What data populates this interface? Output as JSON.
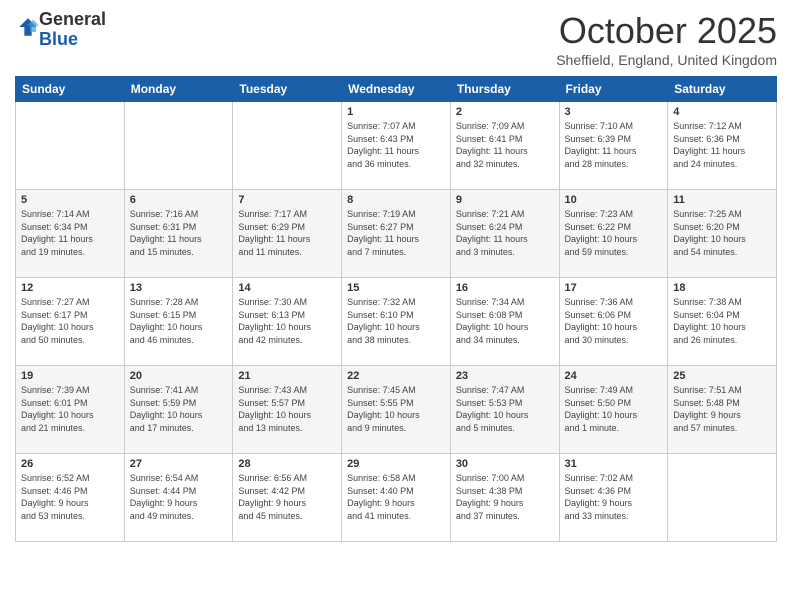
{
  "logo": {
    "general": "General",
    "blue": "Blue"
  },
  "header": {
    "month": "October 2025",
    "location": "Sheffield, England, United Kingdom"
  },
  "weekdays": [
    "Sunday",
    "Monday",
    "Tuesday",
    "Wednesday",
    "Thursday",
    "Friday",
    "Saturday"
  ],
  "weeks": [
    [
      {
        "day": "",
        "info": ""
      },
      {
        "day": "",
        "info": ""
      },
      {
        "day": "",
        "info": ""
      },
      {
        "day": "1",
        "info": "Sunrise: 7:07 AM\nSunset: 6:43 PM\nDaylight: 11 hours\nand 36 minutes."
      },
      {
        "day": "2",
        "info": "Sunrise: 7:09 AM\nSunset: 6:41 PM\nDaylight: 11 hours\nand 32 minutes."
      },
      {
        "day": "3",
        "info": "Sunrise: 7:10 AM\nSunset: 6:39 PM\nDaylight: 11 hours\nand 28 minutes."
      },
      {
        "day": "4",
        "info": "Sunrise: 7:12 AM\nSunset: 6:36 PM\nDaylight: 11 hours\nand 24 minutes."
      }
    ],
    [
      {
        "day": "5",
        "info": "Sunrise: 7:14 AM\nSunset: 6:34 PM\nDaylight: 11 hours\nand 19 minutes."
      },
      {
        "day": "6",
        "info": "Sunrise: 7:16 AM\nSunset: 6:31 PM\nDaylight: 11 hours\nand 15 minutes."
      },
      {
        "day": "7",
        "info": "Sunrise: 7:17 AM\nSunset: 6:29 PM\nDaylight: 11 hours\nand 11 minutes."
      },
      {
        "day": "8",
        "info": "Sunrise: 7:19 AM\nSunset: 6:27 PM\nDaylight: 11 hours\nand 7 minutes."
      },
      {
        "day": "9",
        "info": "Sunrise: 7:21 AM\nSunset: 6:24 PM\nDaylight: 11 hours\nand 3 minutes."
      },
      {
        "day": "10",
        "info": "Sunrise: 7:23 AM\nSunset: 6:22 PM\nDaylight: 10 hours\nand 59 minutes."
      },
      {
        "day": "11",
        "info": "Sunrise: 7:25 AM\nSunset: 6:20 PM\nDaylight: 10 hours\nand 54 minutes."
      }
    ],
    [
      {
        "day": "12",
        "info": "Sunrise: 7:27 AM\nSunset: 6:17 PM\nDaylight: 10 hours\nand 50 minutes."
      },
      {
        "day": "13",
        "info": "Sunrise: 7:28 AM\nSunset: 6:15 PM\nDaylight: 10 hours\nand 46 minutes."
      },
      {
        "day": "14",
        "info": "Sunrise: 7:30 AM\nSunset: 6:13 PM\nDaylight: 10 hours\nand 42 minutes."
      },
      {
        "day": "15",
        "info": "Sunrise: 7:32 AM\nSunset: 6:10 PM\nDaylight: 10 hours\nand 38 minutes."
      },
      {
        "day": "16",
        "info": "Sunrise: 7:34 AM\nSunset: 6:08 PM\nDaylight: 10 hours\nand 34 minutes."
      },
      {
        "day": "17",
        "info": "Sunrise: 7:36 AM\nSunset: 6:06 PM\nDaylight: 10 hours\nand 30 minutes."
      },
      {
        "day": "18",
        "info": "Sunrise: 7:38 AM\nSunset: 6:04 PM\nDaylight: 10 hours\nand 26 minutes."
      }
    ],
    [
      {
        "day": "19",
        "info": "Sunrise: 7:39 AM\nSunset: 6:01 PM\nDaylight: 10 hours\nand 21 minutes."
      },
      {
        "day": "20",
        "info": "Sunrise: 7:41 AM\nSunset: 5:59 PM\nDaylight: 10 hours\nand 17 minutes."
      },
      {
        "day": "21",
        "info": "Sunrise: 7:43 AM\nSunset: 5:57 PM\nDaylight: 10 hours\nand 13 minutes."
      },
      {
        "day": "22",
        "info": "Sunrise: 7:45 AM\nSunset: 5:55 PM\nDaylight: 10 hours\nand 9 minutes."
      },
      {
        "day": "23",
        "info": "Sunrise: 7:47 AM\nSunset: 5:53 PM\nDaylight: 10 hours\nand 5 minutes."
      },
      {
        "day": "24",
        "info": "Sunrise: 7:49 AM\nSunset: 5:50 PM\nDaylight: 10 hours\nand 1 minute."
      },
      {
        "day": "25",
        "info": "Sunrise: 7:51 AM\nSunset: 5:48 PM\nDaylight: 9 hours\nand 57 minutes."
      }
    ],
    [
      {
        "day": "26",
        "info": "Sunrise: 6:52 AM\nSunset: 4:46 PM\nDaylight: 9 hours\nand 53 minutes."
      },
      {
        "day": "27",
        "info": "Sunrise: 6:54 AM\nSunset: 4:44 PM\nDaylight: 9 hours\nand 49 minutes."
      },
      {
        "day": "28",
        "info": "Sunrise: 6:56 AM\nSunset: 4:42 PM\nDaylight: 9 hours\nand 45 minutes."
      },
      {
        "day": "29",
        "info": "Sunrise: 6:58 AM\nSunset: 4:40 PM\nDaylight: 9 hours\nand 41 minutes."
      },
      {
        "day": "30",
        "info": "Sunrise: 7:00 AM\nSunset: 4:38 PM\nDaylight: 9 hours\nand 37 minutes."
      },
      {
        "day": "31",
        "info": "Sunrise: 7:02 AM\nSunset: 4:36 PM\nDaylight: 9 hours\nand 33 minutes."
      },
      {
        "day": "",
        "info": ""
      }
    ]
  ]
}
